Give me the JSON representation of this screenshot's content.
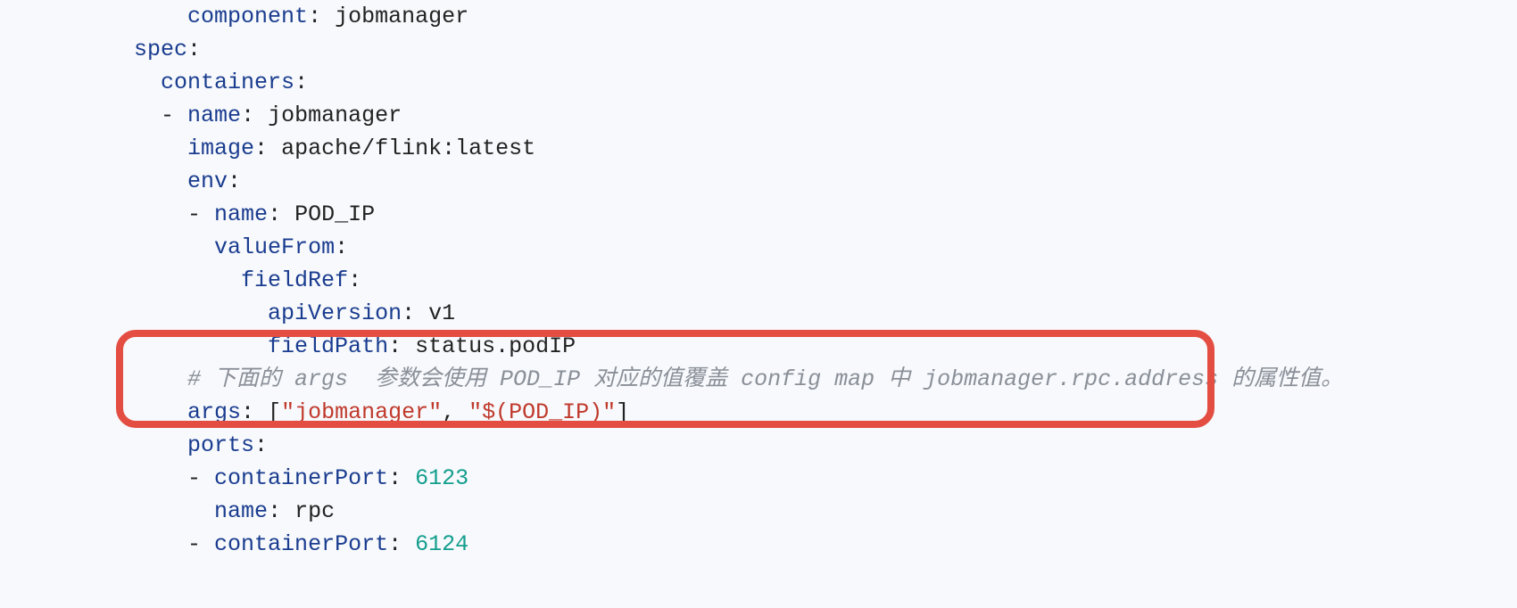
{
  "code": {
    "l1_indent": "            ",
    "l1_key": "component",
    "l1_val": "jobmanager",
    "l2_indent": "        ",
    "l2_key": "spec",
    "l3_indent": "          ",
    "l3_key": "containers",
    "l4_indent": "          ",
    "l4_dash": "- ",
    "l4_key": "name",
    "l4_val": "jobmanager",
    "l5_indent": "            ",
    "l5_key": "image",
    "l5_val": "apache/flink:latest",
    "l6_indent": "            ",
    "l6_key": "env",
    "l7_indent": "            ",
    "l7_dash": "- ",
    "l7_key": "name",
    "l7_val": "POD_IP",
    "l8_indent": "              ",
    "l8_key": "valueFrom",
    "l9_indent": "                ",
    "l9_key": "fieldRef",
    "l10_indent": "                  ",
    "l10_key": "apiVersion",
    "l10_val": "v1",
    "l11_indent": "                  ",
    "l11_key": "fieldPath",
    "l11_val": "status.podIP",
    "l12_indent": "            ",
    "l12_comment": "# 下面的 args  参数会使用 POD_IP 对应的值覆盖 config map 中 jobmanager.rpc.address 的属性值。",
    "l13_indent": "            ",
    "l13_key": "args",
    "l13_b1": "[",
    "l13_s1": "\"jobmanager\"",
    "l13_comma": ", ",
    "l13_s2": "\"$(POD_IP)\"",
    "l13_b2": "]",
    "l14_indent": "            ",
    "l14_key": "ports",
    "l15_indent": "            ",
    "l15_dash": "- ",
    "l15_key": "containerPort",
    "l15_val": "6123",
    "l16_indent": "              ",
    "l16_key": "name",
    "l16_val": "rpc",
    "l17_indent": "            ",
    "l17_dash": "- ",
    "l17_key": "containerPort",
    "l17_val": "6124"
  }
}
